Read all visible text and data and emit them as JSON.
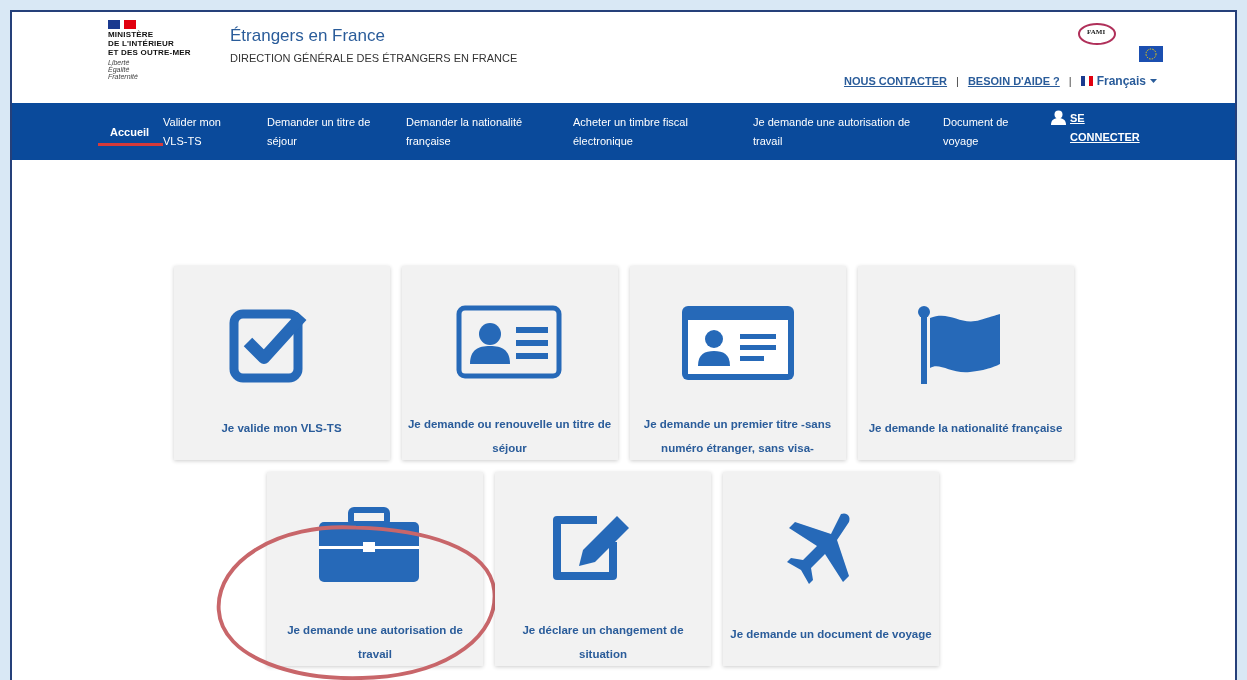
{
  "header": {
    "ministry": [
      "MINISTÈRE",
      "DE L'INTÉRIEUR",
      "ET DES OUTRE-MER"
    ],
    "motto": [
      "Liberté",
      "Égalité",
      "Fraternité"
    ],
    "site_title": "Étrangers en France",
    "site_subtitle": "DIRECTION GÉNÉRALE DES ÉTRANGERS EN FRANCE",
    "partner_logo": "FAMI",
    "links": [
      {
        "label": "NOUS CONTACTER",
        "separator": "|"
      },
      {
        "label": "BESOIN D'AIDE ?",
        "separator": "|"
      }
    ],
    "language": "Français"
  },
  "nav": [
    {
      "label": "Accueil",
      "selected": true
    },
    {
      "label": "Valider mon VLS-TS",
      "selected": false
    },
    {
      "label": "Demander un titre de séjour",
      "selected": false
    },
    {
      "label": "Demander la nationalité française",
      "selected": false
    },
    {
      "label": "Acheter un timbre fiscal électronique",
      "selected": false
    },
    {
      "label": "Je demande une autorisation de travail",
      "selected": false
    },
    {
      "label": "Document de voyage",
      "selected": false
    },
    {
      "label": "SE CONNECTER",
      "kind": "login",
      "selected": false
    }
  ],
  "cards": [
    [
      {
        "kind": "check",
        "label": "Je valide mon VLS-TS",
        "circled": false
      },
      {
        "kind": "idcard",
        "label": "Je demande ou renouvelle un titre de séjour",
        "circled": false
      },
      {
        "kind": "idcard2",
        "label": "Je demande un premier titre -sans numéro étranger, sans visa-",
        "circled": false
      },
      {
        "kind": "flag",
        "label": "Je demande la nationalité française",
        "circled": false
      }
    ],
    [
      {
        "kind": "briefcase",
        "label": "Je demande une autorisation de travail",
        "circled": true
      },
      {
        "kind": "edit",
        "label": "Je déclare un changement de situation",
        "circled": false
      },
      {
        "kind": "plane",
        "label": "Je demande un document de voyage",
        "circled": false
      }
    ]
  ]
}
